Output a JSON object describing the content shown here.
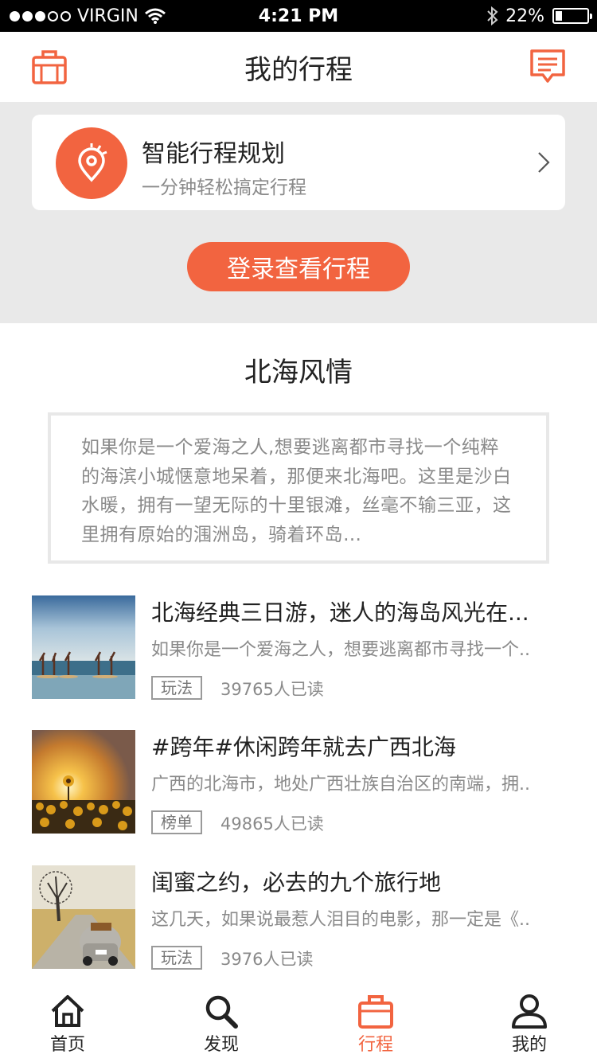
{
  "status_bar": {
    "carrier": "VIRGIN",
    "time": "4:21 PM",
    "battery": "22%",
    "battery_level": 0.22,
    "signal_bars": 3,
    "icons": [
      "signal-dots-icon",
      "wifi-icon",
      "bluetooth-icon",
      "battery-icon"
    ]
  },
  "header": {
    "title": "我的行程",
    "left_icon": "suitcase-icon",
    "right_icon": "message-icon"
  },
  "plan_card": {
    "title": "智能行程规划",
    "subtitle": "一分钟轻松搞定行程",
    "icon": "location-pin-icon"
  },
  "login_button": "登录查看行程",
  "section": {
    "title": "北海风情",
    "intro": "如果你是一个爱海之人,想要逃离都市寻找一个纯粹的海滨小城惬意地呆着，那便来北海吧。这里是沙白水暖，拥有一望无际的十里银滩，丝毫不输三亚，这里拥有原始的涠洲岛，骑着环岛…"
  },
  "articles": [
    {
      "title": "北海经典三日游，迷人的海岛风光在...",
      "desc": "如果你是一个爱海之人，想要逃离都市寻找一个..",
      "tag": "玩法",
      "reads": "39765人已读"
    },
    {
      "title": "#跨年#休闲跨年就去广西北海",
      "desc": "广西的北海市，地处广西壮族自治区的南端，拥..",
      "tag": "榜单",
      "reads": "49865人已读"
    },
    {
      "title": "闺蜜之约，必去的九个旅行地",
      "desc": "这几天，如果说最惹人泪目的电影，那一定是《..",
      "tag": "玩法",
      "reads": "3976人已读"
    }
  ],
  "tabs": [
    {
      "label": "首页",
      "icon": "home-icon",
      "active": false
    },
    {
      "label": "发现",
      "icon": "search-icon",
      "active": false
    },
    {
      "label": "行程",
      "icon": "suitcase-icon",
      "active": true
    },
    {
      "label": "我的",
      "icon": "user-icon",
      "active": false
    }
  ],
  "colors": {
    "accent": "#f26440",
    "gray_bg": "#e9e9e9",
    "text_secondary": "#8a8a8a"
  }
}
